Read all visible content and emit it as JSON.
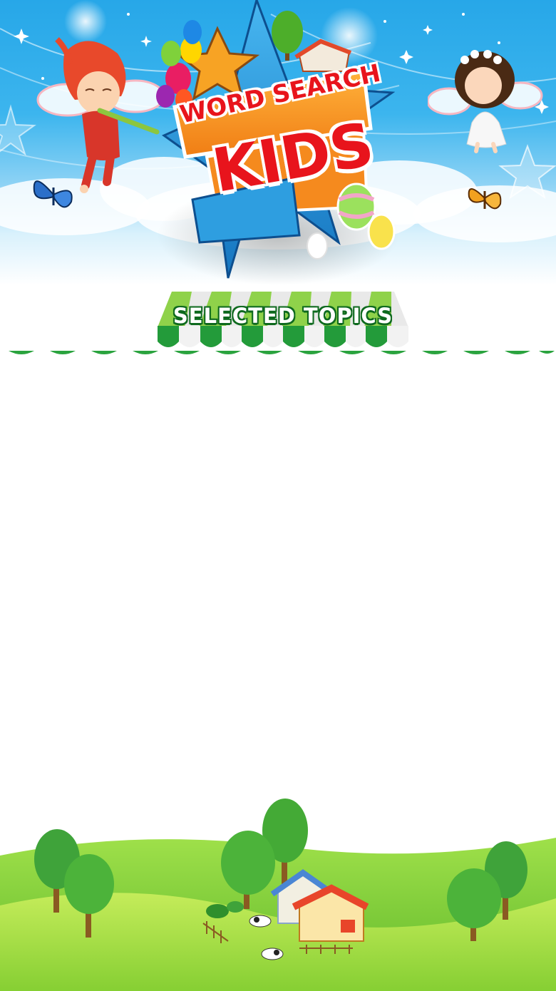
{
  "header": {
    "logo_line1": "WORD SEARCH",
    "logo_line2": "KIDS"
  },
  "section": {
    "title": "SELECTED TOPICS"
  },
  "colors": {
    "sky": "#27a7e8",
    "awning_green": "#2aa33e",
    "awning_light": "#8fd24a",
    "logo_red": "#e8141c",
    "grass": "#8fd63a"
  },
  "decorations": {
    "left_character": "fairy-boy-with-flute",
    "right_character": "fairy-girl",
    "butterflies": [
      "blue-butterfly-icon",
      "orange-butterfly-icon"
    ],
    "logo_items": [
      "star-icon",
      "balloons-icon",
      "house-icon",
      "tree-icon",
      "easter-eggs-icon"
    ]
  }
}
